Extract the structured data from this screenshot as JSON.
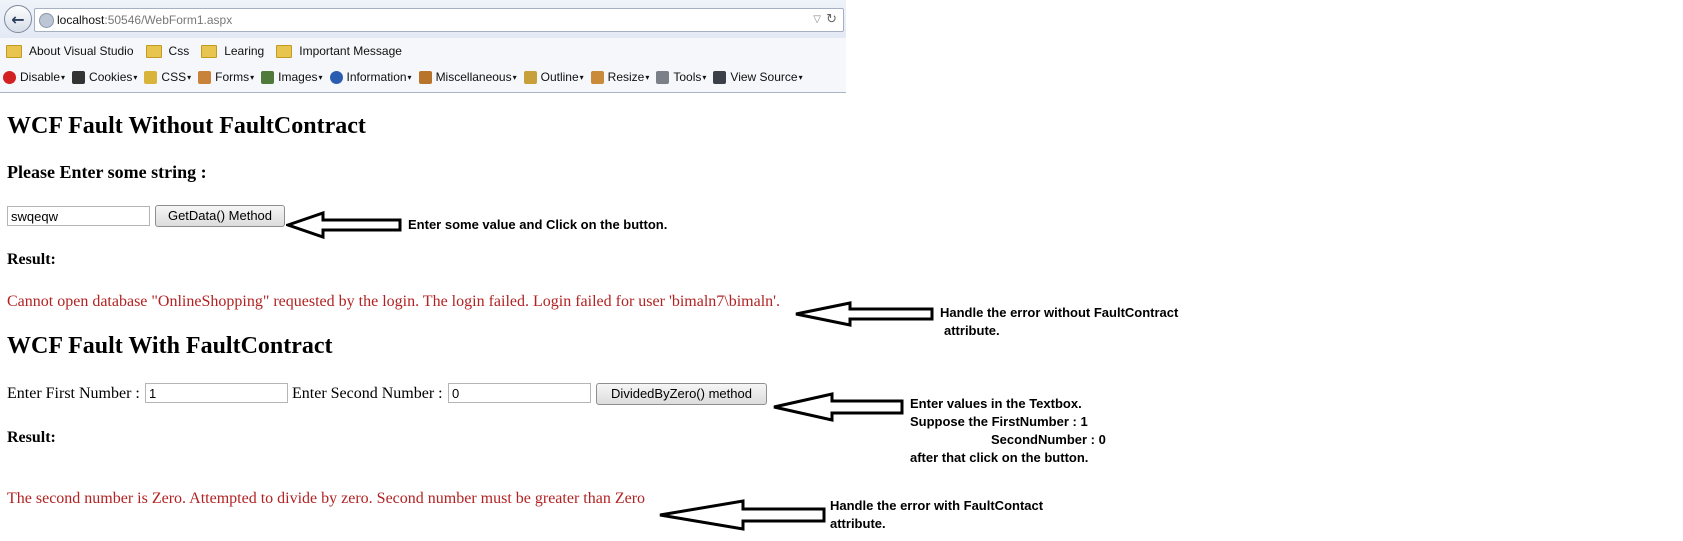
{
  "browser": {
    "url_host": "localhost",
    "url_path": ":50546/WebForm1.aspx",
    "bookmarks": [
      "About Visual Studio",
      "Css",
      "Learing",
      "Important Message"
    ],
    "toolbar": [
      "Disable",
      "Cookies",
      "CSS",
      "Forms",
      "Images",
      "Information",
      "Miscellaneous",
      "Outline",
      "Resize",
      "Tools",
      "View Source"
    ]
  },
  "section1": {
    "title": "WCF Fault Without FaultContract",
    "prompt": "Please Enter some string :",
    "input_value": "swqeqw",
    "button_label": "GetData() Method",
    "result_label": "Result:",
    "error_text": "Cannot open database \"OnlineShopping\" requested by the login. The login failed. Login failed for user 'bimaln7\\bimaln'."
  },
  "section2": {
    "title": "WCF Fault With FaultContract",
    "first_label": "Enter First Number :",
    "first_value": "1",
    "second_label": "Enter Second Number :",
    "second_value": "0",
    "button_label": "DividedByZero() method",
    "result_label": "Result:",
    "error_text": "The second number is Zero. Attempted to divide by zero. Second number must be greater than Zero"
  },
  "annotations": {
    "note1": "Enter some value and Click on the button.",
    "note2_line1": "Handle the error without FaultContract",
    "note2_line2": "attribute.",
    "note3_line1": "Enter values in the Textbox.",
    "note3_line2": "Suppose the FirstNumber : 1",
    "note3_line3": "SecondNumber : 0",
    "note3_line4": "after that click on the button.",
    "note4_line1": "Handle the error with FaultContact",
    "note4_line2": "attribute."
  },
  "colors": {
    "error": "#b22222",
    "folder": "#e8c54e"
  }
}
